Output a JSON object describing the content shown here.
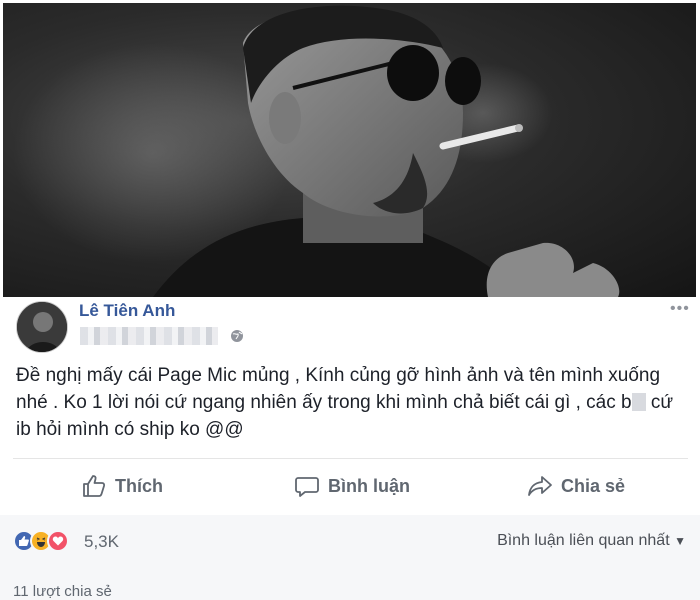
{
  "post": {
    "author_name": "Lê Tiên Anh",
    "text": "Đề nghị mấy cái Page Mic mủng , Kính củng gỡ hình ảnh và tên mình xuống nhé . Ko 1 lời nói cứ ngang nhiên ấy trong khi mình chả biết cái gì , các b",
    "text_tail": " cứ ib hỏi mình có ship ko @@"
  },
  "actions": {
    "like_label": "Thích",
    "comment_label": "Bình luận",
    "share_label": "Chia sẻ"
  },
  "reactions": {
    "count": "5,3K",
    "sort_label": "Bình luận liên quan nhất",
    "share_count": "11 lượt chia sẻ"
  },
  "colors": {
    "link_blue": "#365899",
    "action_gray": "#606770",
    "like_blue": "#4267b2",
    "love_red": "#f25268",
    "haha_yellow": "#f7b125"
  },
  "icons": [
    "globe-icon",
    "more-icon",
    "thumbs-up-icon",
    "comment-icon",
    "share-icon",
    "like-reaction-icon",
    "haha-reaction-icon",
    "love-reaction-icon",
    "caret-down-icon"
  ]
}
